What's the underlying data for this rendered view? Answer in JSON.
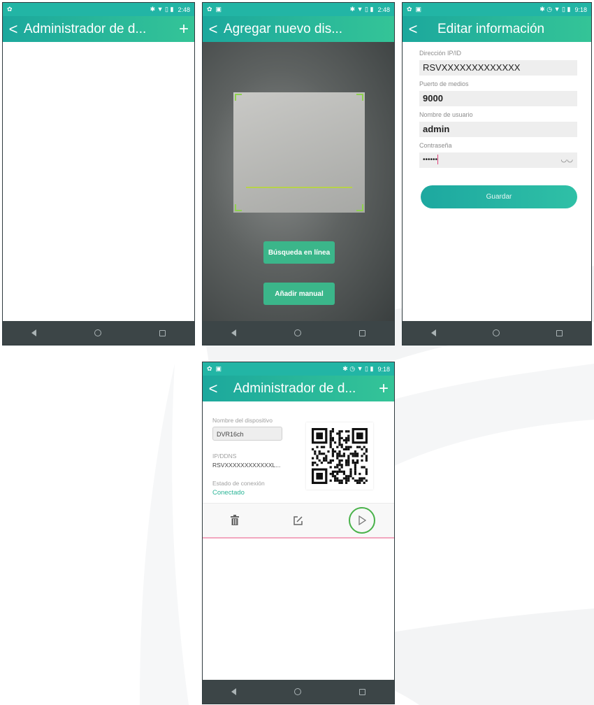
{
  "colors": {
    "accent": "#22b5a5",
    "button_green": "#3bb68a",
    "status_green": "#2bb597",
    "nav_bar": "#3c4547"
  },
  "screens": [
    {
      "status": {
        "time": "2:48"
      },
      "appbar": {
        "title": "Administrador de d...",
        "has_add": true
      }
    },
    {
      "status": {
        "time": "2:48"
      },
      "appbar": {
        "title": "Agregar nuevo dis..."
      },
      "buttons": {
        "online_search": "Búsqueda en línea",
        "manual_add": "Añadir manual"
      }
    },
    {
      "status": {
        "time": "9:18"
      },
      "appbar": {
        "title": "Editar información"
      },
      "form": {
        "ip_label": "Dirección IP/ID",
        "ip_value": "RSVXXXXXXXXXXXXX",
        "port_label": "Puerto de medios",
        "port_value": "9000",
        "user_label": "Nombre de usuario",
        "user_value": "admin",
        "password_label": "Contraseña",
        "password_value": "••••••"
      },
      "save_label": "Guardar"
    },
    {
      "status": {
        "time": "9:18"
      },
      "appbar": {
        "title": "Administrador de d...",
        "has_add": true
      },
      "device": {
        "name_label": "Nombre del dispositivo",
        "name_value": "DVR16ch",
        "id_label": "IP/DDNS",
        "id_value": "RSVXXXXXXXXXXXXL...",
        "status_label": "Estado de conexión",
        "status_value": "Conectado"
      },
      "icons": {
        "delete": "trash-icon",
        "edit": "edit-icon",
        "play": "play-icon"
      }
    }
  ]
}
